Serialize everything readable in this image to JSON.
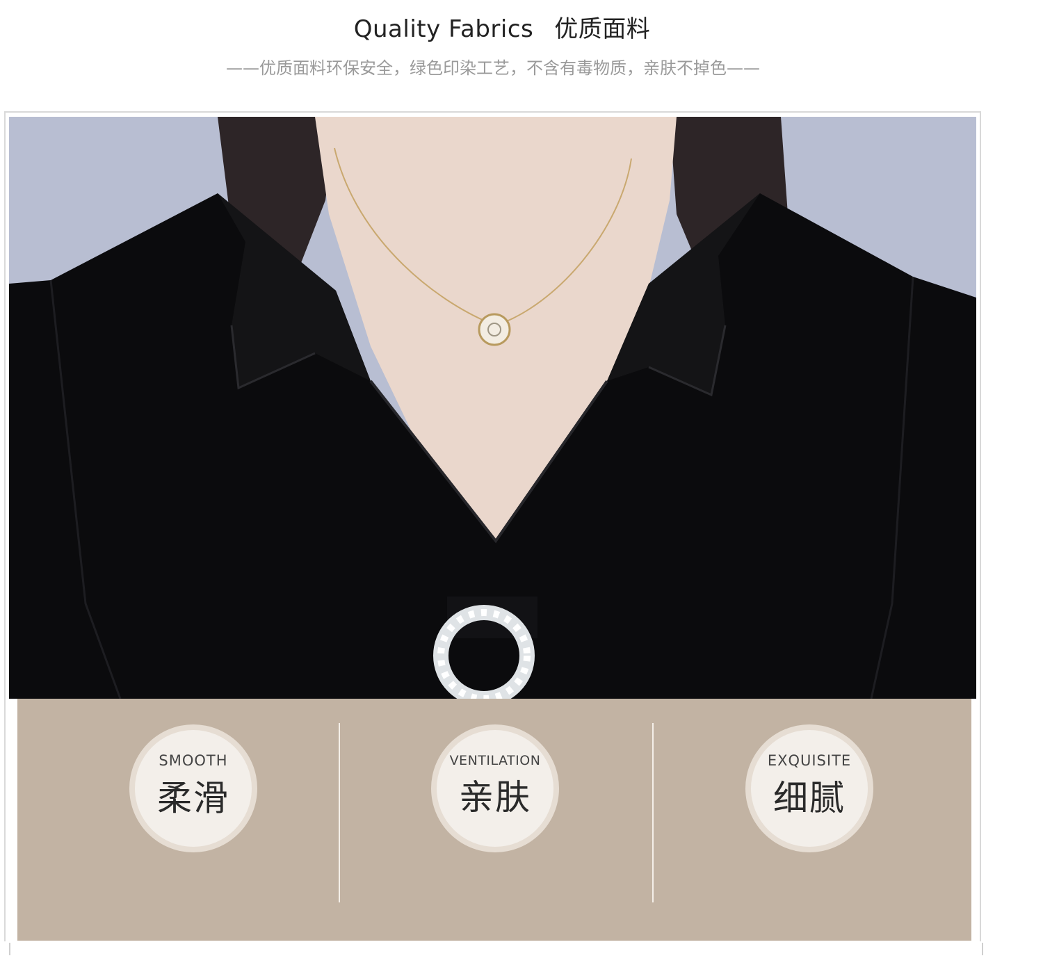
{
  "header": {
    "title_en": "Quality Fabrics",
    "title_cn": "优质面料",
    "subtitle": "——优质面料环保安全，绿色印染工艺，不含有毒物质，亲肤不掉色——"
  },
  "features": [
    {
      "en": "SMOOTH",
      "cn": "柔滑"
    },
    {
      "en": "VENTILATION",
      "cn": "亲肤"
    },
    {
      "en": "EXQUISITE",
      "cn": "细腻"
    }
  ],
  "colors": {
    "band": "#c2b3a3",
    "badge_outer": "#e6ddd3",
    "badge_inner": "#f3efea",
    "blouse": "#0b0b0d",
    "background_wall": "#b9bfd2"
  }
}
